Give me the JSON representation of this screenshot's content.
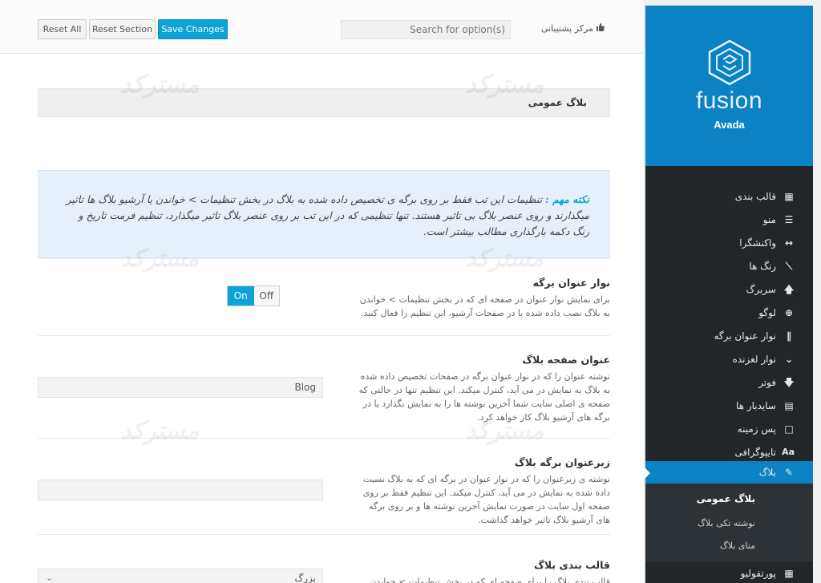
{
  "header": {
    "reset_all": "Reset All",
    "reset_section": "Reset Section",
    "save_changes": "Save Changes",
    "search_placeholder": "(Search for option(s",
    "support_label": "مرکز پشتیبانی"
  },
  "section": {
    "title": "بلاگ عمومی"
  },
  "notice": {
    "label": "نکته مهم :",
    "text": "تنظیمات این تب فقط بر روی برگه ی تخصیص داده شده به بلاگ در بخش تنظیمات > خواندن یا آرشیو بلاگ ها تاثیر میگذارند و روی عنصر بلاگ بی تاثیر هستند. تنها تنظیمی که در این تب بر روی عنصر بلاگ تاثیر میگذارد، تنظیم فرمت تاریخ و رنگ دکمه بارگذاری مطالب بیشتر است."
  },
  "options": [
    {
      "title": "نوار عنوان برگه",
      "desc": "برای نمایش نوار عنوان در صفحه ای که در بخش تنظیمات > خواندن به بلاگ نصب داده شده یا در صفحات آرشیو، این تنظیم را فعال کنید.",
      "on": "On",
      "off": "Off",
      "state": "on"
    },
    {
      "title": "عنوان صفحه بلاگ",
      "desc": "نوشته عنوان را که در نوار عنوان برگه در صفحات تخصیص داده شده به بلاگ به نمایش در می آید، کنترل میکند. این تنظیم تنها در حالتی که صفحه ی اصلی سایت شما آخرین نوشته ها را به نمایش بگذارد یا در برگه های آرشیو بلاگ کار خواهد کرد.",
      "value": "Blog"
    },
    {
      "title": "زیرعنوان برگه بلاگ",
      "desc": "نوشته ی زیرعنوان را که در نوار عنوان در برگه ای که به بلاگ نسبت داده شده به نمایش در می آید، کنترل میکند. این تنظیم فقط بر روی صفحه اول سایت در صورت نمایش آخرین نوشته ها و بر روی برگه های آرشیو بلاگ تاثیر خواهد گذاشت.",
      "value": ""
    },
    {
      "title": "قالب بندی بلاگ",
      "desc": "قالب بندی بلاگ را برای صفحه ای که در بخش تنظیمات > خواندن",
      "value": "بزرگ"
    }
  ],
  "watermark": "مسترکد",
  "sidebar": {
    "brand": "fusion",
    "product": "Avada",
    "items": [
      {
        "label": "قالب بندی",
        "icon": "layout-icon"
      },
      {
        "label": "منو",
        "icon": "menu-icon"
      },
      {
        "label": "واکنشگرا",
        "icon": "responsive-icon"
      },
      {
        "label": "رنگ ها",
        "icon": "brush-icon"
      },
      {
        "label": "سربرگ",
        "icon": "header-arrow-icon"
      },
      {
        "label": "لوگو",
        "icon": "plus-circle-icon"
      },
      {
        "label": "نوار عنوان برگه",
        "icon": "sliders-icon"
      },
      {
        "label": "نوار لغزنده",
        "icon": "chevron-down-icon"
      },
      {
        "label": "فوتر",
        "icon": "footer-arrow-icon"
      },
      {
        "label": "سایدبار ها",
        "icon": "sidebar-icon"
      },
      {
        "label": "پس زمینه",
        "icon": "monitor-icon"
      },
      {
        "label": "تایپوگرافی",
        "icon": "typography-icon"
      },
      {
        "label": "بلاگ",
        "icon": "edit-icon"
      },
      {
        "label": "پورتفولیو",
        "icon": "grid-icon"
      }
    ],
    "sub_items": [
      "بلاگ عمومی",
      "نوشته تکی بلاگ",
      "متای بلاگ"
    ]
  },
  "colors": {
    "accent": "#0b82c4",
    "button": "#0ea2d6",
    "sidebar_bg": "#222628"
  }
}
